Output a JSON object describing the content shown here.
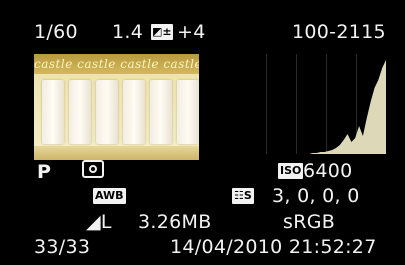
{
  "top": {
    "shutter": "1/60",
    "aperture": "1.4",
    "exposure_comp": "+4",
    "file_number": "100-2115"
  },
  "thumbnail": {
    "banner_text": "castle castle castle castle castle"
  },
  "histogram": {
    "fill_color": "#ddd9b8",
    "levels": [
      0,
      0,
      0,
      0,
      0,
      0,
      0,
      0,
      0,
      0,
      0,
      0,
      0,
      0,
      0,
      0,
      0,
      0,
      0,
      0,
      1,
      1,
      2,
      2,
      3,
      4,
      6,
      9,
      14,
      20,
      12,
      16,
      28,
      18,
      36,
      52,
      66,
      74,
      86,
      94
    ]
  },
  "mid": {
    "mode": "P",
    "metering_icon": "evaluative-metering-icon",
    "iso_label": "ISO",
    "iso": "6400"
  },
  "row3": {
    "wb": "AWB",
    "picture_style": "☷S",
    "params": "3,  0,  0,  0"
  },
  "row4": {
    "quality": "◢L",
    "file_size": "3.26MB",
    "color_space": "sRGB"
  },
  "bottom": {
    "counter": "33/33",
    "datetime": "14/04/2010  21:52:27"
  }
}
